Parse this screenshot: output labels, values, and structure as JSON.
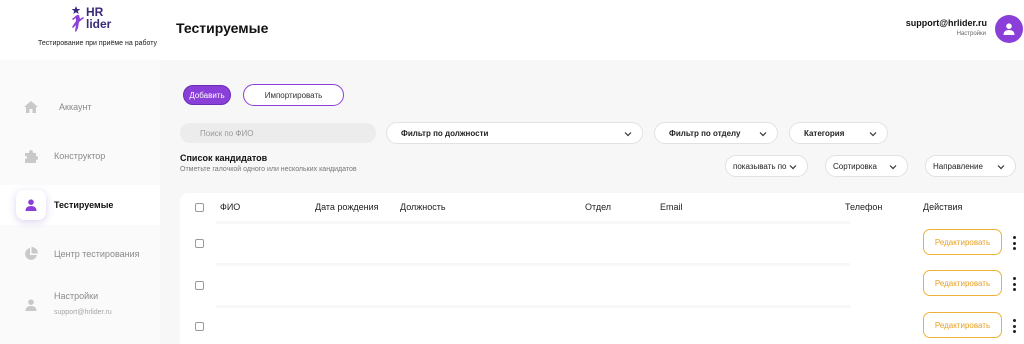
{
  "brand": {
    "logo_line1": "HR",
    "logo_line2": "lider",
    "tagline": "Тестирование при приёме на работу"
  },
  "sidebar": {
    "items": [
      {
        "label": "Аккаунт",
        "icon": "home-icon",
        "active": false
      },
      {
        "label": "Конструктор",
        "icon": "puzzle-icon",
        "active": false
      },
      {
        "label": "Тестируемые",
        "icon": "user-icon",
        "active": true
      },
      {
        "label": "Центр тестирования",
        "icon": "pie-chart-icon",
        "active": false
      },
      {
        "label": "Настройки",
        "icon": "user-icon",
        "active": false,
        "sub": "support@hrlider.ru"
      }
    ]
  },
  "header": {
    "title": "Тестируемые",
    "user_email": "support@hrlider.ru",
    "user_settings": "Настройки"
  },
  "toolbar": {
    "add_label": "Добавить",
    "import_label": "Импортировать"
  },
  "filters": {
    "search_placeholder": "Поиск по ФИО",
    "position": "Фильтр по должности",
    "department": "Фильтр по отделу",
    "category": "Категория",
    "show_by": "показывать по",
    "sort": "Сортировка",
    "direction": "Направление"
  },
  "list": {
    "title": "Список кандидатов",
    "subtitle": "Отметьте галочкой одного или нескольких кандидатов"
  },
  "table": {
    "columns": [
      "ФИО",
      "Дата рождения",
      "Должность",
      "Отдел",
      "Email",
      "Телефон",
      "Действия"
    ],
    "rows": [
      {
        "action_label": "Редактировать"
      },
      {
        "action_label": "Редактировать"
      },
      {
        "action_label": "Редактировать"
      }
    ]
  },
  "colors": {
    "accent": "#8b3fd9",
    "edit_button": "#e8a021"
  }
}
